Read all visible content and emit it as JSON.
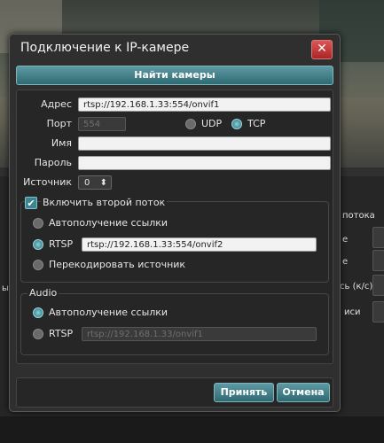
{
  "background_window": {
    "labels": [
      "потока",
      "е",
      "е",
      "сь (к/с)",
      "иси",
      "ы ("
    ]
  },
  "dialog": {
    "title": "Подключение к IP-камере",
    "close_glyph": "✕",
    "find_cameras_label": "Найти камеры",
    "address": {
      "label": "Адрес",
      "value": "rtsp://192.168.1.33:554/onvif1"
    },
    "port": {
      "label": "Порт",
      "value": "554"
    },
    "protocol": {
      "options": [
        "UDP",
        "TCP"
      ],
      "selected": "TCP"
    },
    "name": {
      "label": "Имя",
      "value": ""
    },
    "password": {
      "label": "Пароль",
      "value": ""
    },
    "source": {
      "label": "Источник",
      "value": "0",
      "arrow": "⬍"
    },
    "second_stream": {
      "checkbox_label": "Включить второй поток",
      "checked": true,
      "check_glyph": "✔",
      "auto_link_label": "Автополучение ссылки",
      "rtsp_label": "RTSP",
      "rtsp_value": "rtsp://192.168.1.33:554/onvif2",
      "transcode_label": "Перекодировать источник",
      "selected": "RTSP"
    },
    "audio": {
      "group_title": "Audio",
      "auto_link_label": "Автополучение ссылки",
      "rtsp_label": "RTSP",
      "rtsp_value": "rtsp://192.168.1.33/onvif1",
      "selected": "Автополучение ссылки"
    },
    "accept_label": "Принять",
    "cancel_label": "Отмена"
  }
}
